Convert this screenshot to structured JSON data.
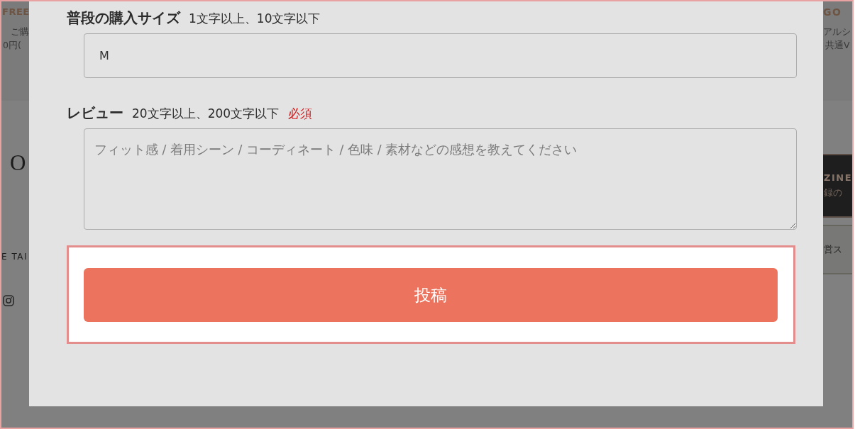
{
  "background_page": {
    "left_column": {
      "banner": [
        {
          "kind": "title",
          "text": "FREE"
        },
        {
          "kind": "line",
          "text": "ご購"
        },
        {
          "kind": "line",
          "text": "0円("
        }
      ],
      "footer": [
        {
          "kind": "logo",
          "text": "O"
        },
        {
          "kind": "link",
          "text": "E TAI"
        },
        {
          "kind": "social"
        }
      ]
    },
    "right_column": {
      "banner": [
        {
          "kind": "title",
          "text": "GO"
        },
        {
          "kind": "line",
          "text": "アルシ"
        },
        {
          "kind": "line",
          "text": "共通V"
        }
      ],
      "footer": [
        {
          "kind": "dark_box",
          "lines": [
            "ZINE",
            "録の"
          ]
        },
        {
          "kind": "light_box",
          "lines": [
            "営ス"
          ]
        }
      ]
    }
  },
  "modal": {
    "fields": [
      {
        "kind": "input",
        "label": "普段の購入サイズ",
        "hint": "1文字以上、10文字以下",
        "value": "M"
      },
      {
        "kind": "textarea",
        "label": "レビュー",
        "hint": "20文字以上、200文字以下",
        "required_badge": "必須",
        "placeholder": "フィット感 / 着用シーン / コーディネート / 色味 / 素材などの感想を教えてください"
      }
    ],
    "submit_button": "投稿"
  }
}
